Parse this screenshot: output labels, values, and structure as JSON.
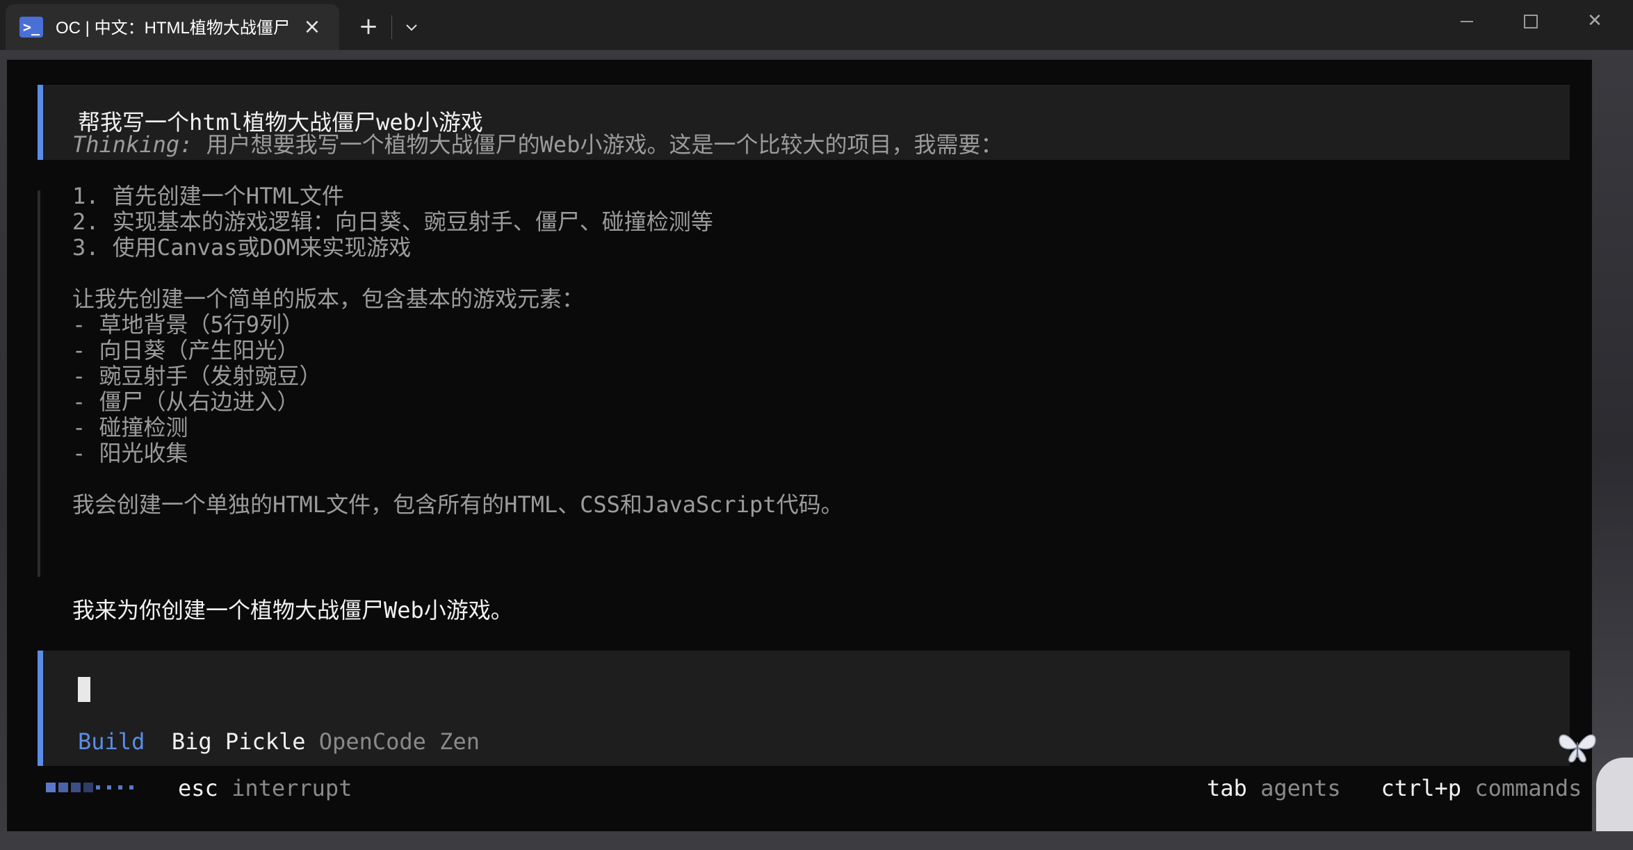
{
  "window": {
    "tab_title": "OC | 中文：HTML植物大战僵尸",
    "tab_icon": "terminal-icon",
    "close_glyph": "×",
    "new_tab_glyph": "+",
    "dropdown_glyph": "⌄",
    "minimize_icon": "minimize-icon",
    "maximize_icon": "maximize-icon",
    "window_close_glyph": "✕"
  },
  "conversation": {
    "user_message": "帮我写一个html植物大战僵尸web小游戏",
    "thinking_label": "Thinking:",
    "thinking_intro": " 用户想要我写一个植物大战僵尸的Web小游戏。这是一个比较大的项目，我需要：",
    "steps": [
      "1. 首先创建一个HTML文件",
      "2. 实现基本的游戏逻辑：向日葵、豌豆射手、僵尸、碰撞检测等",
      "3. 使用Canvas或DOM来实现游戏"
    ],
    "plan_intro": "让我先创建一个简单的版本，包含基本的游戏元素：",
    "elements": [
      "- 草地背景（5行9列）",
      "- 向日葵（产生阳光）",
      "- 豌豆射手（发射豌豆）",
      "- 僵尸（从右边进入）",
      "- 碰撞检测",
      "- 阳光收集"
    ],
    "plan_outro": "我会创建一个单独的HTML文件，包含所有的HTML、CSS和JavaScript代码。",
    "answer": "我来为你创建一个植物大战僵尸Web小游戏。"
  },
  "prompt": {
    "mode": "Build",
    "model": "Big Pickle",
    "provider": "OpenCode Zen"
  },
  "status": {
    "left_key": "esc",
    "left_hint": "interrupt",
    "agents_key": "tab",
    "agents_hint": "agents",
    "commands_key": "ctrl+p",
    "commands_hint": "commands"
  },
  "colors": {
    "accent": "#5b8de8",
    "terminal_bg": "#0a0a0a",
    "block_bg": "#1e1e1e",
    "muted_text": "#9c9c9c",
    "primary_text": "#f2f2f2"
  }
}
